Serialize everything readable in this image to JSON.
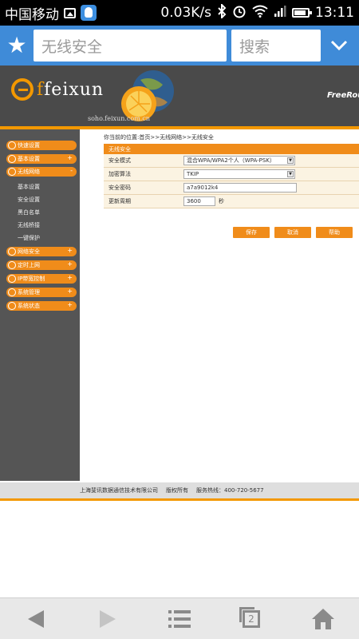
{
  "status_bar": {
    "carrier": "中国移动",
    "speed": "0.03K/s",
    "time": "13:11"
  },
  "browser": {
    "url_text": "无线安全",
    "search_label": "搜索"
  },
  "router_header": {
    "brand_prefix": "f",
    "brand_name": "feixun",
    "site": "soho.feixun.com.cn",
    "tagline": "FreeRout"
  },
  "sidebar": {
    "menu": [
      {
        "label": "快速设置",
        "has_plus": false
      },
      {
        "label": "基本设置",
        "has_plus": true
      },
      {
        "label": "无线网络",
        "has_plus": false
      },
      {
        "label": "网络安全",
        "has_plus": true
      },
      {
        "label": "定时上网",
        "has_plus": true
      },
      {
        "label": "IP带宽控制",
        "has_plus": true
      },
      {
        "label": "系统管理",
        "has_plus": true
      },
      {
        "label": "系统状态",
        "has_plus": true
      }
    ],
    "subitems": [
      "基本设置",
      "安全设置",
      "黑白名单",
      "无线桥接",
      "一键保护"
    ]
  },
  "breadcrumb": "你当前的位置:首页>>无线网络>>无线安全",
  "panel": {
    "title": "无线安全",
    "rows": [
      {
        "label": "安全模式",
        "value": "混合WPA/WPA2个人（WPA-PSK）"
      },
      {
        "label": "加密算法",
        "value": "TKIP"
      },
      {
        "label": "安全密码",
        "value": "a7a9012k4"
      },
      {
        "label": "更新周期",
        "value": "3600",
        "unit": "秒"
      }
    ]
  },
  "buttons": {
    "save": "保存",
    "cancel": "取消",
    "help": "帮助"
  },
  "footer": {
    "company": "上海斐讯数据通信技术有限公司",
    "rights": "版权所有",
    "hotline": "服务热线：400-720-5677"
  },
  "nav": {
    "tab_count": "2"
  }
}
